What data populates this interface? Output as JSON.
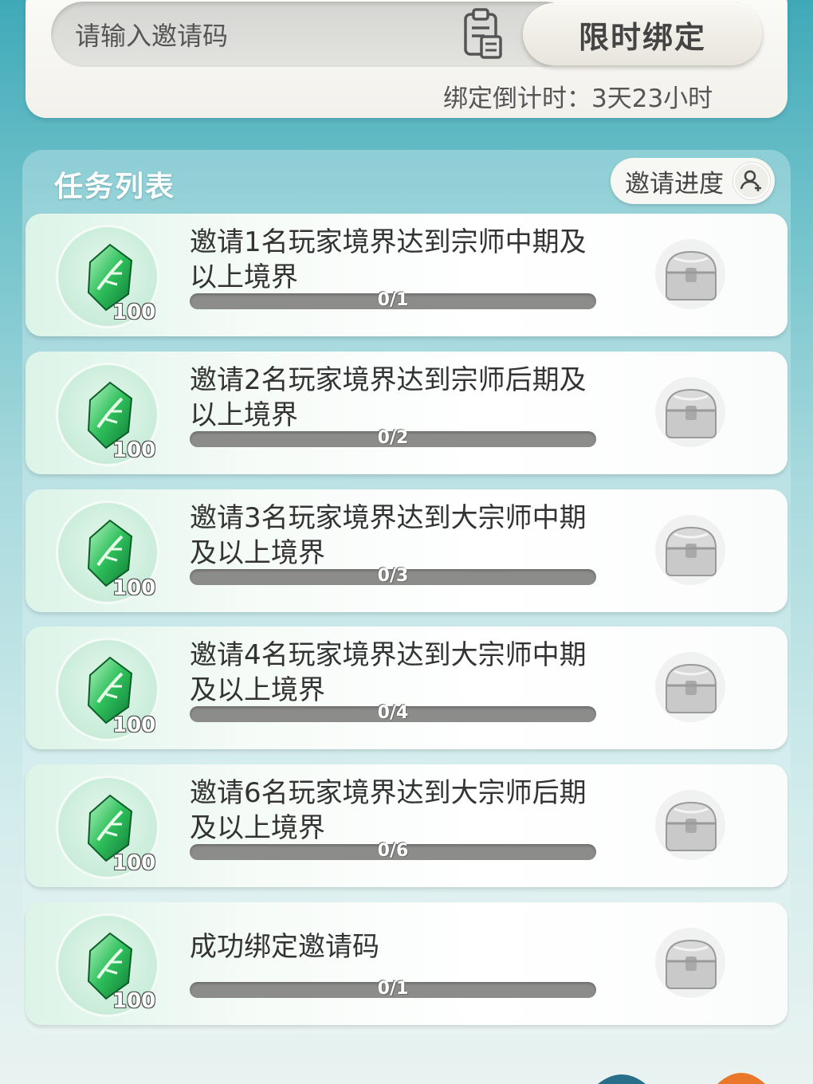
{
  "bind": {
    "input_placeholder": "请输入邀请码",
    "button_label": "限时绑定",
    "countdown_label": "绑定倒计时：",
    "countdown_value": "3天23小时"
  },
  "tasks_section": {
    "title": "任务列表",
    "progress_button_label": "邀请进度"
  },
  "tasks": [
    {
      "title": "邀请1名玩家境界达到宗师中期及以上境界",
      "reward_count": "100",
      "progress_text": "0/1",
      "progress": 0
    },
    {
      "title": "邀请2名玩家境界达到宗师后期及以上境界",
      "reward_count": "100",
      "progress_text": "0/2",
      "progress": 0
    },
    {
      "title": "邀请3名玩家境界达到大宗师中期及以上境界",
      "reward_count": "100",
      "progress_text": "0/3",
      "progress": 0
    },
    {
      "title": "邀请4名玩家境界达到大宗师中期及以上境界",
      "reward_count": "100",
      "progress_text": "0/4",
      "progress": 0
    },
    {
      "title": "邀请6名玩家境界达到大宗师后期及以上境界",
      "reward_count": "100",
      "progress_text": "0/6",
      "progress": 0
    },
    {
      "title": "成功绑定邀请码",
      "reward_count": "100",
      "progress_text": "0/1",
      "progress": 0
    }
  ],
  "icons": {
    "paste": "clipboard-icon",
    "progress": "person-add-icon",
    "reward": "green-gem-icon",
    "chest": "treasure-chest-icon"
  },
  "colors": {
    "accent_teal": "#3fa9b8",
    "gem_green": "#2fbf5c",
    "bar_gray": "#8c8c8a"
  }
}
